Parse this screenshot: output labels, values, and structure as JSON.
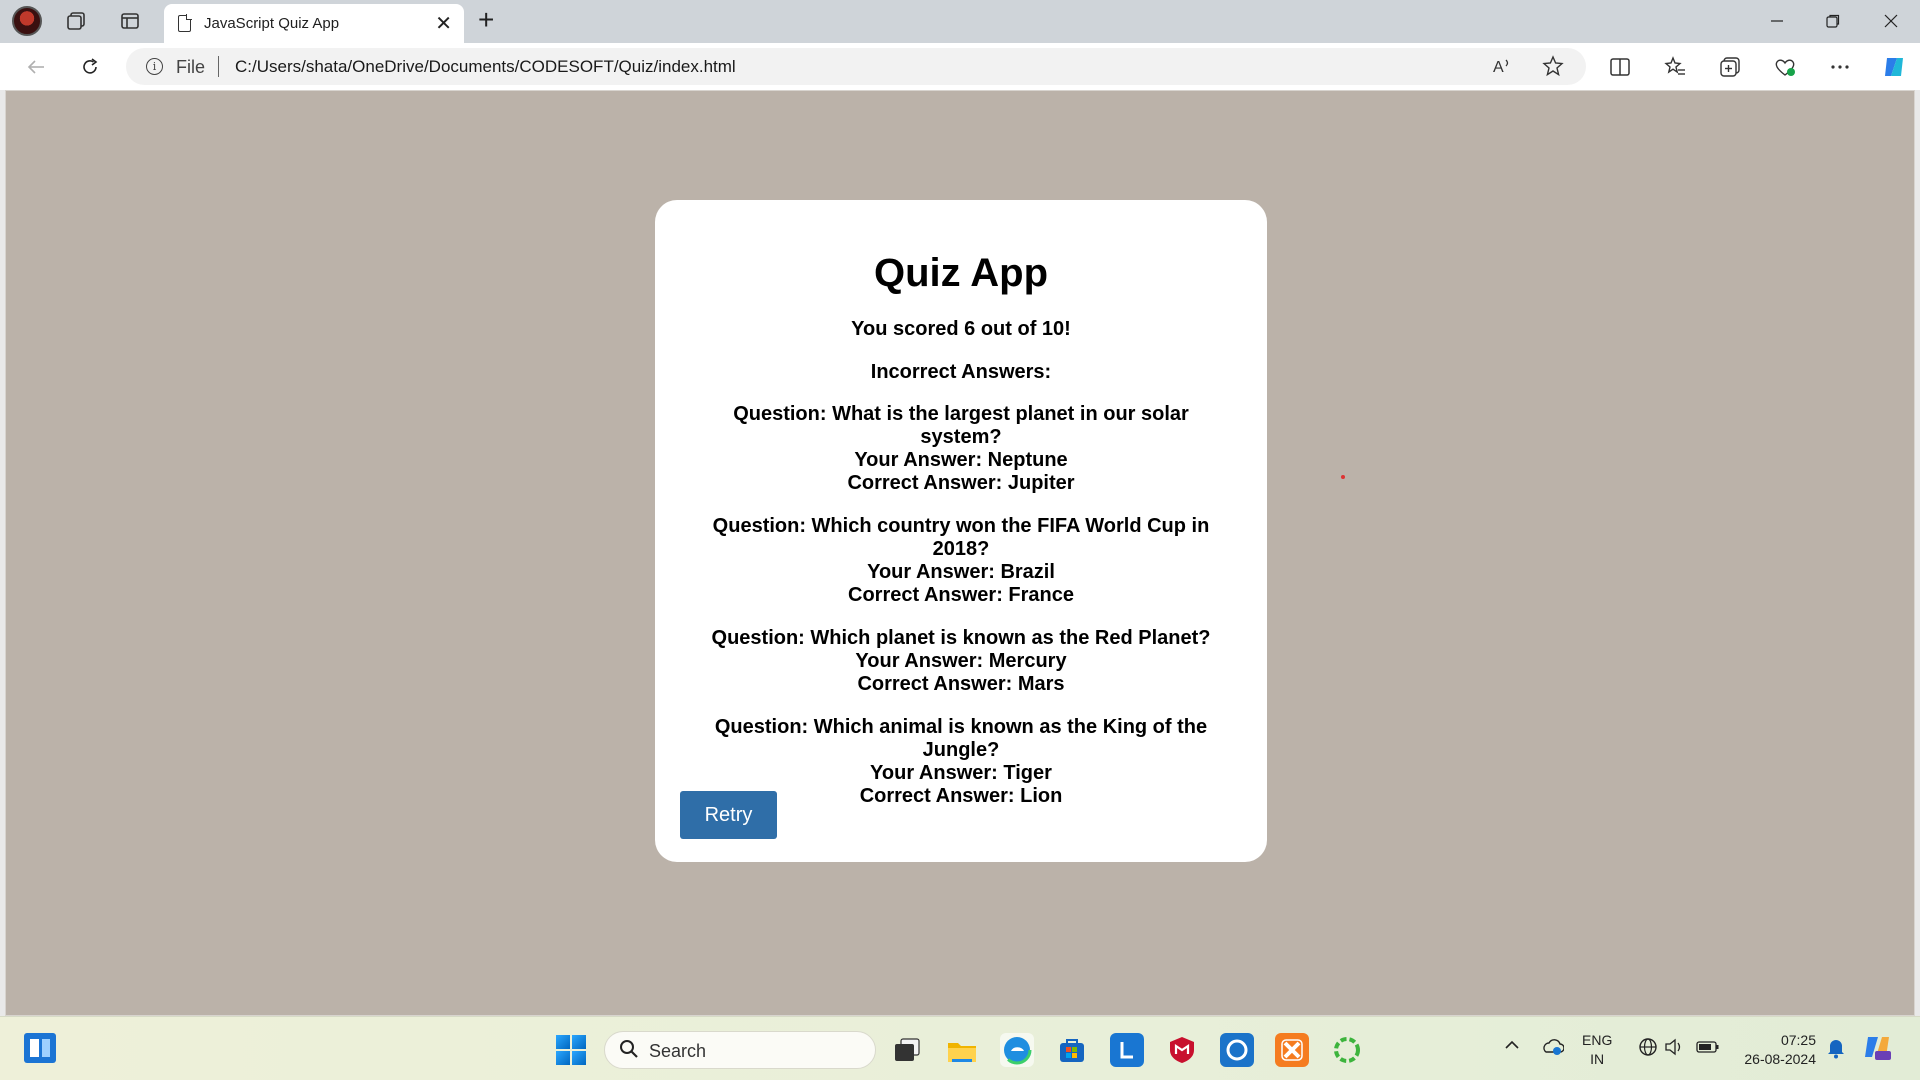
{
  "browser": {
    "tab_title": "JavaScript Quiz App",
    "tab_close_glyph": "✕",
    "new_tab_glyph": "+",
    "scheme_label": "File",
    "url": "C:/Users/shata/OneDrive/Documents/CODESOFT/Quiz/index.html",
    "icons": [
      "profile-avatar-icon",
      "workspaces-icon",
      "tab-actions-icon",
      "page-icon",
      "back-arrow-icon",
      "refresh-icon",
      "info-icon",
      "read-aloud-icon",
      "favorite-star-icon",
      "split-screen-icon",
      "favorites-icon",
      "collections-icon",
      "browser-essentials-icon",
      "more-menu-icon",
      "copilot-icon",
      "minimize-icon",
      "restore-icon",
      "close-icon"
    ]
  },
  "quiz": {
    "title": "Quiz App",
    "score_text": "You scored 6 out of 10!",
    "incorrect_heading": "Incorrect Answers:",
    "results": [
      {
        "question": "Question: What is the largest planet in our solar system?",
        "your_answer": "Your Answer: Neptune",
        "correct_answer": "Correct Answer: Jupiter"
      },
      {
        "question": "Question: Which country won the FIFA World Cup in 2018?",
        "your_answer": "Your Answer: Brazil",
        "correct_answer": "Correct Answer: France"
      },
      {
        "question": "Question: Which planet is known as the Red Planet?",
        "your_answer": "Your Answer: Mercury",
        "correct_answer": "Correct Answer: Mars"
      },
      {
        "question": "Question: Which animal is known as the King of the Jungle?",
        "your_answer": "Your Answer: Tiger",
        "correct_answer": "Correct Answer: Lion"
      }
    ],
    "retry_label": "Retry",
    "colors": {
      "background": "#bbb2a9",
      "card": "#ffffff",
      "button": "#2f6ea8"
    }
  },
  "taskbar": {
    "search_placeholder": "Search",
    "apps": [
      "widgets-icon",
      "start-icon",
      "task-view-icon",
      "file-explorer-icon",
      "edge-icon",
      "microsoft-store-icon",
      "l-app-icon",
      "mcafee-icon",
      "alexa-icon",
      "xampp-icon",
      "ring-app-icon"
    ],
    "tray_icons": [
      "chevron-up-icon",
      "onedrive-icon",
      "network-icon",
      "volume-icon",
      "battery-icon",
      "notification-bell-icon",
      "copilot-pre-icon"
    ],
    "language_line1": "ENG",
    "language_line2": "IN",
    "time": "07:25",
    "date": "26-08-2024"
  }
}
